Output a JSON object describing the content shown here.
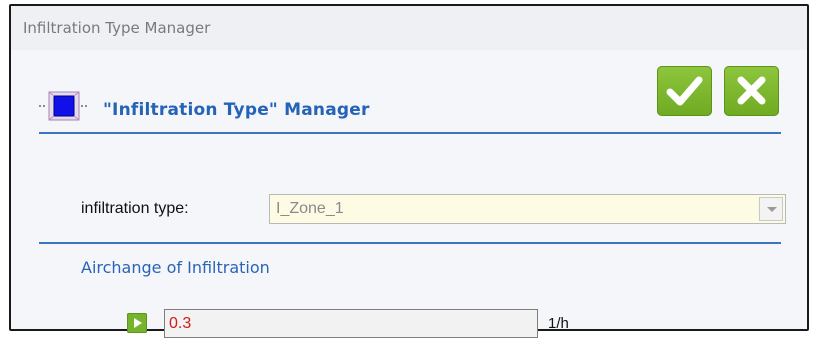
{
  "window": {
    "title": "Infiltration Type Manager"
  },
  "header": {
    "title": "\"Infiltration Type\" Manager",
    "icon": "selected-object-icon",
    "ok_icon": "checkmark-icon",
    "cancel_icon": "close-x-icon"
  },
  "form": {
    "type_label": "infiltration type:",
    "type_value": "I_Zone_1",
    "type_arrow_icon": "chevron-down-icon"
  },
  "section": {
    "title": "Airchange of Infiltration",
    "run_icon": "play-icon",
    "value": "0.3",
    "unit": "1/h"
  },
  "colors": {
    "accent_blue": "#2463b7",
    "button_green": "#7cb830",
    "combo_background": "#fdfbe3",
    "value_red": "#d11b1b"
  }
}
